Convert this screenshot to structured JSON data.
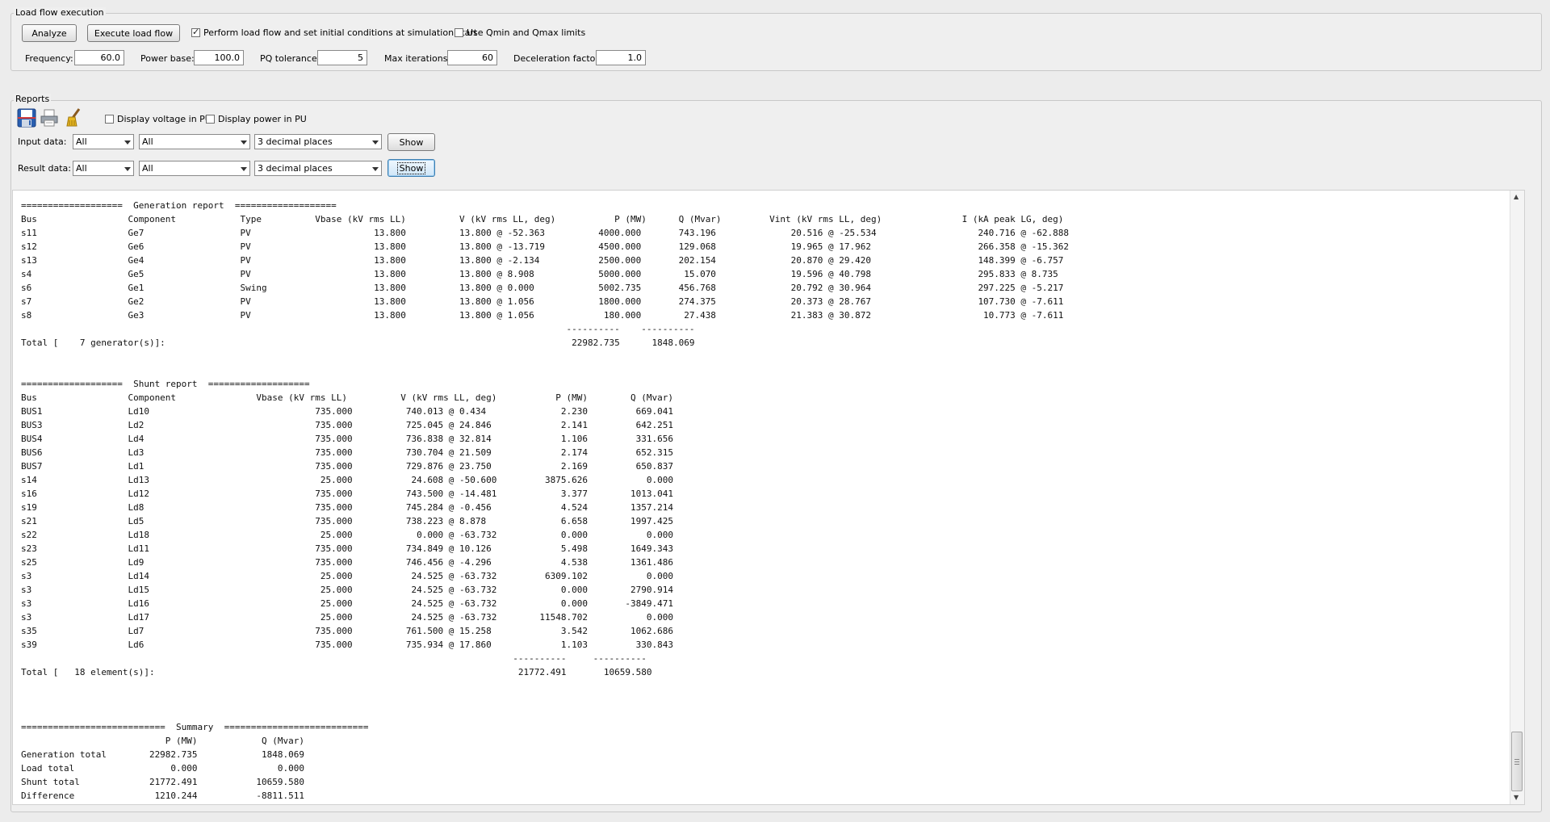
{
  "lf": {
    "title": "Load flow execution",
    "analyze_label": "Analyze",
    "execute_label": "Execute load flow",
    "perform_label": "Perform load flow and set initial conditions at simulation start",
    "perform_checked": true,
    "qlimits_label": "Use Qmin and Qmax limits",
    "qlimits_checked": false,
    "frequency_label": "Frequency:",
    "frequency": "60.0",
    "power_base_label": "Power base:",
    "power_base": "100.0",
    "pq_tol_label": "PQ tolerance:",
    "pq_tol": "5",
    "max_iter_label": "Max iterations:",
    "max_iter": "60",
    "decel_label": "Deceleration factor:",
    "decel": "1.0"
  },
  "reports": {
    "title": "Reports",
    "icons": [
      "save-icon",
      "print-icon",
      "clear-icon"
    ],
    "voltage_pu_label": "Display voltage in PU",
    "power_pu_label": "Display power in PU",
    "input_label": "Input data:",
    "input_sel1": "All",
    "input_sel2": "All",
    "input_sel3": "3 decimal places",
    "input_show": "Show",
    "result_label": "Result data:",
    "result_sel1": "All",
    "result_sel2": "All",
    "result_sel3": "3 decimal places",
    "result_show": "Show"
  },
  "report_text": "===================  Generation report  ===================\nBus                 Component            Type          Vbase (kV rms LL)          V (kV rms LL, deg)           P (MW)      Q (Mvar)         Vint (kV rms LL, deg)               I (kA peak LG, deg)\ns11                 Ge7                  PV                       13.800          13.800 @ -52.363          4000.000       743.196              20.516 @ -25.534                   240.716 @ -62.888\ns12                 Ge6                  PV                       13.800          13.800 @ -13.719          4500.000       129.068              19.965 @ 17.962                    266.358 @ -15.362\ns13                 Ge4                  PV                       13.800          13.800 @ -2.134           2500.000       202.154              20.870 @ 29.420                    148.399 @ -6.757\ns4                  Ge5                  PV                       13.800          13.800 @ 8.908            5000.000        15.070              19.596 @ 40.798                    295.833 @ 8.735\ns6                  Ge1                  Swing                    13.800          13.800 @ 0.000            5002.735       456.768              20.792 @ 30.964                    297.225 @ -5.217\ns7                  Ge2                  PV                       13.800          13.800 @ 1.056            1800.000       274.375              20.373 @ 28.767                    107.730 @ -7.611\ns8                  Ge3                  PV                       13.800          13.800 @ 1.056             180.000        27.438              21.383 @ 30.872                     10.773 @ -7.611\n                                                                                                      ----------    ----------\nTotal [    7 generator(s)]:                                                                            22982.735      1848.069\n\n\n===================  Shunt report  ===================\nBus                 Component               Vbase (kV rms LL)          V (kV rms LL, deg)           P (MW)        Q (Mvar)\nBUS1                Ld10                               735.000          740.013 @ 0.434              2.230         669.041\nBUS3                Ld2                                735.000          725.045 @ 24.846             2.141         642.251\nBUS4                Ld4                                735.000          736.838 @ 32.814             1.106         331.656\nBUS6                Ld3                                735.000          730.704 @ 21.509             2.174         652.315\nBUS7                Ld1                                735.000          729.876 @ 23.750             2.169         650.837\ns14                 Ld13                                25.000           24.608 @ -50.600         3875.626           0.000\ns16                 Ld12                               735.000          743.500 @ -14.481            3.377        1013.041\ns19                 Ld8                                735.000          745.284 @ -0.456             4.524        1357.214\ns21                 Ld5                                735.000          738.223 @ 8.878              6.658        1997.425\ns22                 Ld18                                25.000            0.000 @ -63.732            0.000           0.000\ns23                 Ld11                               735.000          734.849 @ 10.126             5.498        1649.343\ns25                 Ld9                                735.000          746.456 @ -4.296             4.538        1361.486\ns3                  Ld14                                25.000           24.525 @ -63.732         6309.102           0.000\ns3                  Ld15                                25.000           24.525 @ -63.732            0.000        2790.914\ns3                  Ld16                                25.000           24.525 @ -63.732            0.000       -3849.471\ns3                  Ld17                                25.000           24.525 @ -63.732        11548.702           0.000\ns35                 Ld7                                735.000          761.500 @ 15.258             3.542        1062.686\ns39                 Ld6                                735.000          735.934 @ 17.860             1.103         330.843\n                                                                                            ----------     ----------\nTotal [   18 element(s)]:                                                                    21772.491       10659.580\n\n\n\n===========================  Summary  ===========================\n                           P (MW)            Q (Mvar)\nGeneration total        22982.735            1848.069\nLoad total                  0.000               0.000\nShunt total             21772.491           10659.580\nDifference               1210.244           -8811.511"
}
